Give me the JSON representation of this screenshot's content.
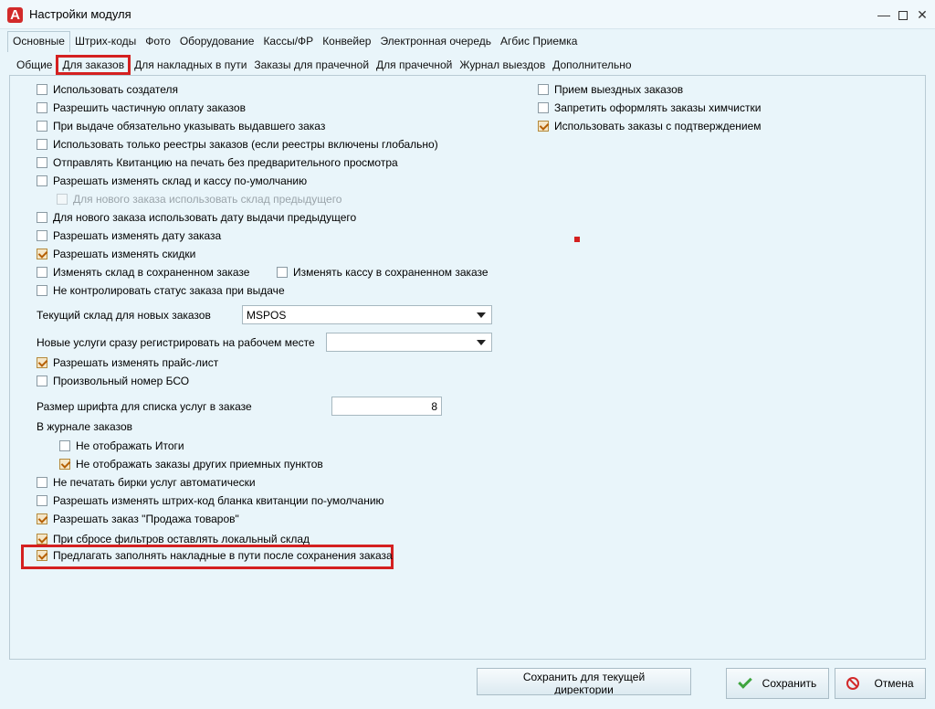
{
  "window": {
    "title": "Настройки модуля",
    "app_icon_letter": "A",
    "min_glyph": "—",
    "close_glyph": "✕"
  },
  "main_tabs": [
    {
      "label": "Основные",
      "active": true
    },
    {
      "label": "Штрих-коды"
    },
    {
      "label": "Фото"
    },
    {
      "label": "Оборудование"
    },
    {
      "label": "Кассы/ФР"
    },
    {
      "label": "Конвейер"
    },
    {
      "label": "Электронная очередь"
    },
    {
      "label": "Агбис Приемка"
    }
  ],
  "sub_tabs": [
    {
      "label": "Общие"
    },
    {
      "label": "Для заказов",
      "active": true
    },
    {
      "label": "Для накладных в пути"
    },
    {
      "label": "Заказы для прачечной"
    },
    {
      "label": "Для прачечной"
    },
    {
      "label": "Журнал выездов"
    },
    {
      "label": "Дополнительно"
    }
  ],
  "left_options": {
    "use_creator": {
      "label": "Использовать создателя",
      "checked": false
    },
    "partial_payment": {
      "label": "Разрешить частичную оплату заказов",
      "checked": false
    },
    "issuer_required": {
      "label": "При выдаче обязательно указывать выдавшего заказ",
      "checked": false
    },
    "registry_only": {
      "label": "Использовать только реестры заказов (если реестры включены глобально)",
      "checked": false
    },
    "print_receipt": {
      "label": "Отправлять Квитанцию на печать без предварительного просмотра",
      "checked": false
    },
    "change_warehouse_cash": {
      "label": "Разрешать изменять склад и кассу по-умолчанию",
      "checked": false
    },
    "prev_warehouse": {
      "label": "Для нового заказа использовать склад предыдущего",
      "checked": false
    },
    "prev_issue_date": {
      "label": "Для нового заказа использовать дату выдачи предыдущего",
      "checked": false
    },
    "change_order_date": {
      "label": "Разрешать изменять дату заказа",
      "checked": false
    },
    "change_discounts": {
      "label": "Разрешать изменять скидки",
      "checked": true
    },
    "change_saved_warehouse": {
      "label": "Изменять склад в сохраненном заказе",
      "checked": false
    },
    "change_saved_cash": {
      "label": "Изменять кассу в сохраненном заказе",
      "checked": false
    },
    "no_status_control": {
      "label": "Не контролировать статус заказа при выдаче",
      "checked": false
    },
    "change_pricelist": {
      "label": "Разрешать изменять прайс-лист",
      "checked": true
    },
    "arbitrary_bso": {
      "label": "Произвольный номер БСО",
      "checked": false
    },
    "hide_totals": {
      "label": "Не отображать Итоги",
      "checked": false
    },
    "hide_other_points": {
      "label": "Не отображать заказы других приемных пунктов",
      "checked": true
    },
    "no_tag_print": {
      "label": "Не печатать бирки услуг автоматически",
      "checked": false
    },
    "change_barcode": {
      "label": "Разрешать изменять штрих-код бланка квитанции по-умолчанию",
      "checked": false
    },
    "sale_order": {
      "label": "Разрешать заказ \"Продажа товаров\"",
      "checked": true
    },
    "keep_local_warehouse": {
      "label": "При сбросе фильтров оставлять локальный склад",
      "checked": true
    },
    "offer_transit_invoices": {
      "label": "Предлагать заполнять накладные в пути после сохранения заказа",
      "checked": true
    }
  },
  "right_options": {
    "field_orders": {
      "label": "Прием выездных заказов",
      "checked": false
    },
    "forbid_drycleaning": {
      "label": "Запретить оформлять заказы химчистки",
      "checked": false
    },
    "confirm_orders": {
      "label": "Использовать заказы с подтверждением",
      "checked": true
    }
  },
  "fields": {
    "current_warehouse_label": "Текущий склад для новых заказов",
    "current_warehouse_value": "MSPOS",
    "register_workplace_label": "Новые услуги сразу регистрировать на рабочем месте",
    "register_workplace_value": "",
    "font_size_label": "Размер шрифта для списка услуг в заказе",
    "font_size_value": "8",
    "journal_section_label": "В журнале заказов"
  },
  "buttons": {
    "save_dir": "Сохранить для текущей директории",
    "save": "Сохранить",
    "cancel": "Отмена"
  },
  "colors": {
    "highlight": "#d42020",
    "background": "#e9f5fa",
    "check": "#b55f00"
  }
}
